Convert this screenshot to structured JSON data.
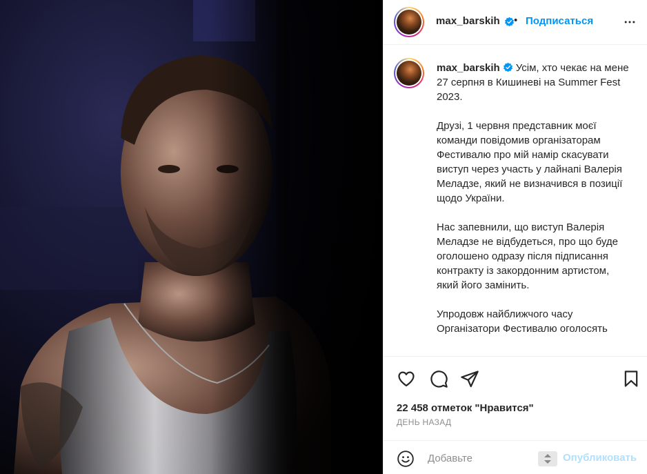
{
  "post": {
    "username": "max_barskih",
    "separator": "•",
    "follow_label": "Подписаться",
    "caption": "Усім, хто чекає на мене 27 серпня в Кишиневі на Summer Fest 2023.\n\nДрузі, 1 червня представник моєї команди повідомив організаторам Фестивалю про мій намір скасувати виступ через участь у лайнапі Валерія Меладзе, який не визначився в позиції щодо України.\n\nНас запевнили, що виступ Валерія Меладзе не відбудеться, про що буде оголошено одразу після підписання контракту із закордонним артистом, який його замінить.\n\nУпродовж найближчого часу Організатори Фестивалю оголосять",
    "likes": "22 458 отметок \"Нравится\"",
    "time": "ДЕНЬ НАЗАД"
  },
  "comment": {
    "placeholder": "Добавьте",
    "publish_label": "Опубликовать"
  },
  "colors": {
    "accent": "#0095f6",
    "publish_disabled": "#b2dffc",
    "muted": "#8e8e8e",
    "text": "#262626"
  },
  "icons": {
    "verified": "verified-badge-icon",
    "more": "more-dots-icon",
    "like": "heart-icon",
    "comment": "comment-icon",
    "share": "paper-plane-icon",
    "save": "bookmark-icon",
    "emoji": "smiley-icon"
  }
}
